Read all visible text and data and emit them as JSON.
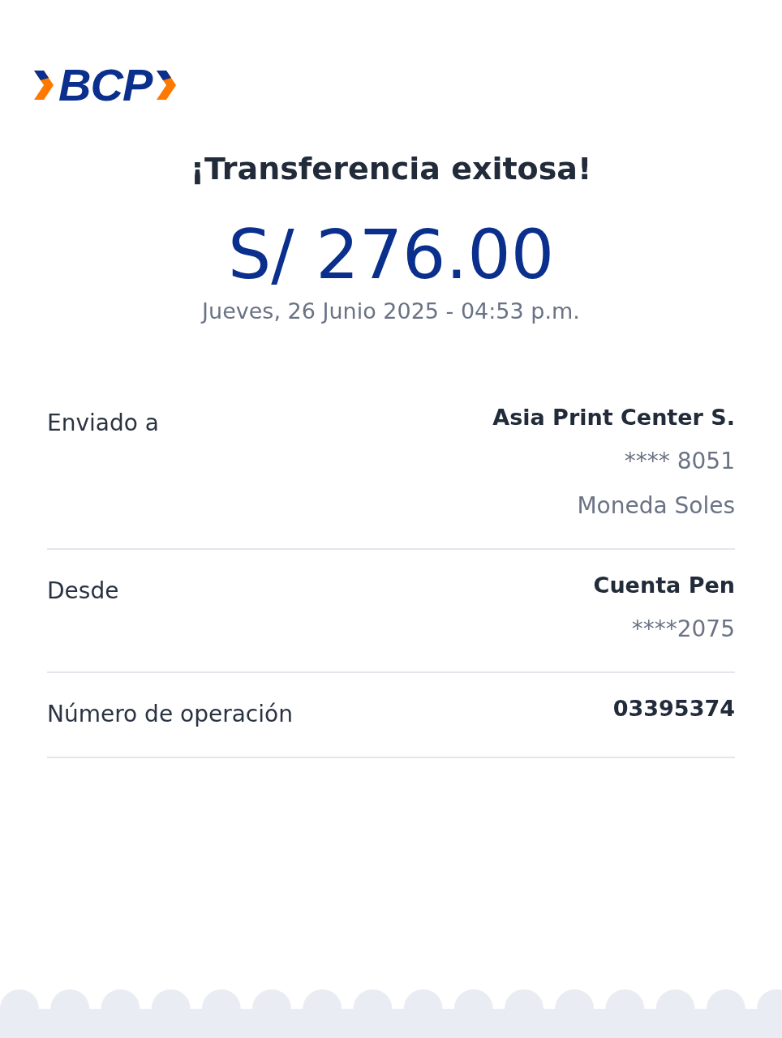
{
  "logo": {
    "text": "BCP"
  },
  "title": "¡Transferencia exitosa!",
  "amount": "S/ 276.00",
  "datetime": "Jueves, 26 Junio 2025 - 04:53 p.m.",
  "details": [
    {
      "label": "Enviado a",
      "values": [
        {
          "text": "Asia Print Center S.",
          "kind": "strong"
        },
        {
          "text": "**** 8051",
          "kind": "muted"
        },
        {
          "text": "Moneda Soles",
          "kind": "muted"
        }
      ]
    },
    {
      "label": "Desde",
      "values": [
        {
          "text": "Cuenta Pen",
          "kind": "strong"
        },
        {
          "text": "****2075",
          "kind": "muted"
        }
      ]
    },
    {
      "label": "Número de operación",
      "values": [
        {
          "text": "03395374",
          "kind": "strong"
        }
      ]
    }
  ]
}
